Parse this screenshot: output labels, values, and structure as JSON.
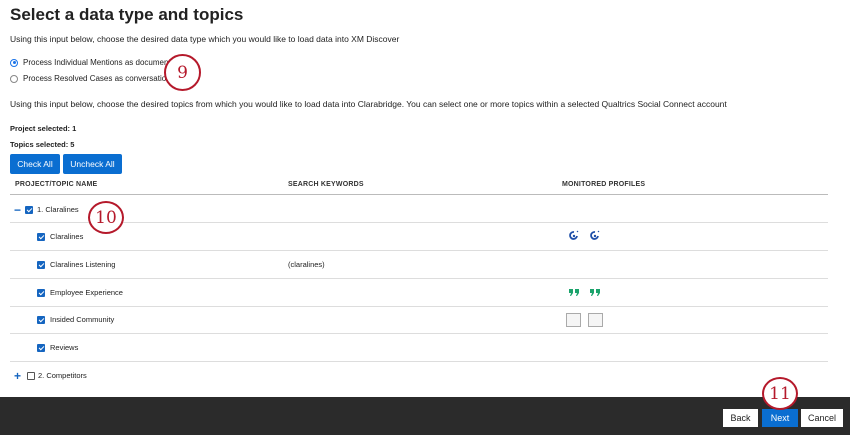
{
  "page": {
    "title": "Select a data type and topics",
    "data_type_prompt": "Using this input below, choose the desired data type which you would like to load data into XM Discover",
    "topics_prompt": "Using this input below, choose the desired topics from which you would like to load data into Clarabridge. You can select one or more topics within a selected Qualtrics Social Connect account"
  },
  "data_type": {
    "options": [
      {
        "label": "Process Individual Mentions as documents",
        "selected": true
      },
      {
        "label": "Process Resolved Cases as conversations",
        "selected": false
      }
    ]
  },
  "stats": {
    "project_selected": "Project selected: 1",
    "topics_selected": "Topics selected: 5"
  },
  "actions": {
    "check_all": "Check All",
    "uncheck_all": "Uncheck All"
  },
  "table": {
    "headers": [
      "PROJECT/TOPIC NAME",
      "SEARCH KEYWORDS",
      "MONITORED PROFILES"
    ],
    "projects": [
      {
        "name": "1. Claralines",
        "checked": true,
        "expanded": true,
        "expander": "−",
        "topics": [
          {
            "name": "Claralines",
            "keywords": "",
            "checked": true,
            "profiles": "blue-swirl-icon"
          },
          {
            "name": "Claralines Listening",
            "keywords": "(claralines)",
            "checked": true,
            "profiles": ""
          },
          {
            "name": "Employee Experience",
            "keywords": "",
            "checked": true,
            "profiles": "green-quote-icon"
          },
          {
            "name": "Insided Community",
            "keywords": "",
            "checked": true,
            "profiles": "broken-image-icon"
          },
          {
            "name": "Reviews",
            "keywords": "",
            "checked": true,
            "profiles": ""
          }
        ]
      },
      {
        "name": "2. Competitors",
        "checked": false,
        "expanded": false,
        "expander": "+",
        "topics": []
      }
    ]
  },
  "callouts": {
    "radio": "9",
    "tree": "10",
    "next": "11"
  },
  "footer": {
    "back": "Back",
    "next": "Next",
    "cancel": "Cancel"
  },
  "colors": {
    "accent": "#0a6ed1",
    "callout": "#b5192b",
    "footer_bg": "#2b2b2b",
    "profile_green": "#1aa36b",
    "profile_blue": "#1f4fa8"
  }
}
